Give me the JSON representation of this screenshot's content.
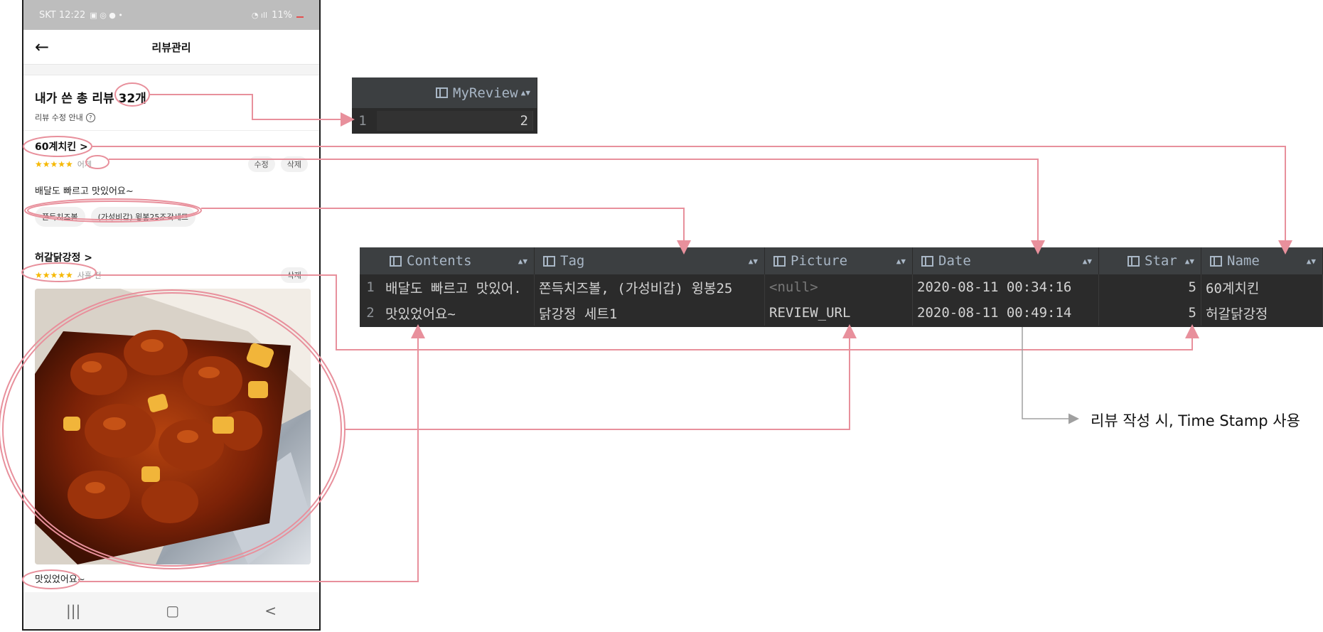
{
  "phone": {
    "statusbar": {
      "left": "SKT 12:22",
      "right": "11%"
    },
    "appbar": {
      "back_icon": "arrow-left-icon",
      "title": "리뷰관리"
    },
    "summary": {
      "title": "내가 쓴 총 리뷰 ",
      "count": "32개",
      "guide": "리뷰 수정 안내",
      "guide_icon": "question-icon"
    },
    "reviews": [
      {
        "store": "60계치킨 >",
        "stars": "★★★★★",
        "date": "어제",
        "actions": [
          "수정",
          "삭제"
        ],
        "text": "배달도 빠르고 맛있어요~",
        "tags": [
          "쫀득치즈볼",
          "(가성비갑) 윙봉25조각세트"
        ]
      },
      {
        "store": "허갈닭강정 >",
        "stars": "★★★★★",
        "date": "사흘 전",
        "actions": [
          "삭제"
        ],
        "text": "맛있었어요~"
      }
    ],
    "navbar": [
      "|||",
      "▢",
      "<"
    ]
  },
  "myreview_grid": {
    "column": "MyReview",
    "rows": [
      {
        "num": "1",
        "value": "2"
      }
    ]
  },
  "review_grid": {
    "columns": [
      "Contents",
      "Tag",
      "Picture",
      "Date",
      "Star",
      "Name"
    ],
    "rows": [
      {
        "num": "1",
        "contents": "배달도 빠르고 맛있어.",
        "tag": "쫀득치즈볼, (가성비갑) 윙봉25",
        "picture": "<null>",
        "date": "2020-08-11 00:34:16",
        "star": "5",
        "name": "60계치킨"
      },
      {
        "num": "2",
        "contents": "맛있었어요~",
        "tag": "닭강정 세트1",
        "picture": "REVIEW_URL",
        "date": "2020-08-11 00:49:14",
        "star": "5",
        "name": "허갈닭강정"
      }
    ]
  },
  "note": "리뷰 작성 시, Time Stamp 사용",
  "colors": {
    "annotation": "#e8909c",
    "grid_bg": "#2b2b2b",
    "grid_header": "#3c3f41",
    "star": "#f6b800",
    "gray_arrow": "#a0a0a0"
  }
}
